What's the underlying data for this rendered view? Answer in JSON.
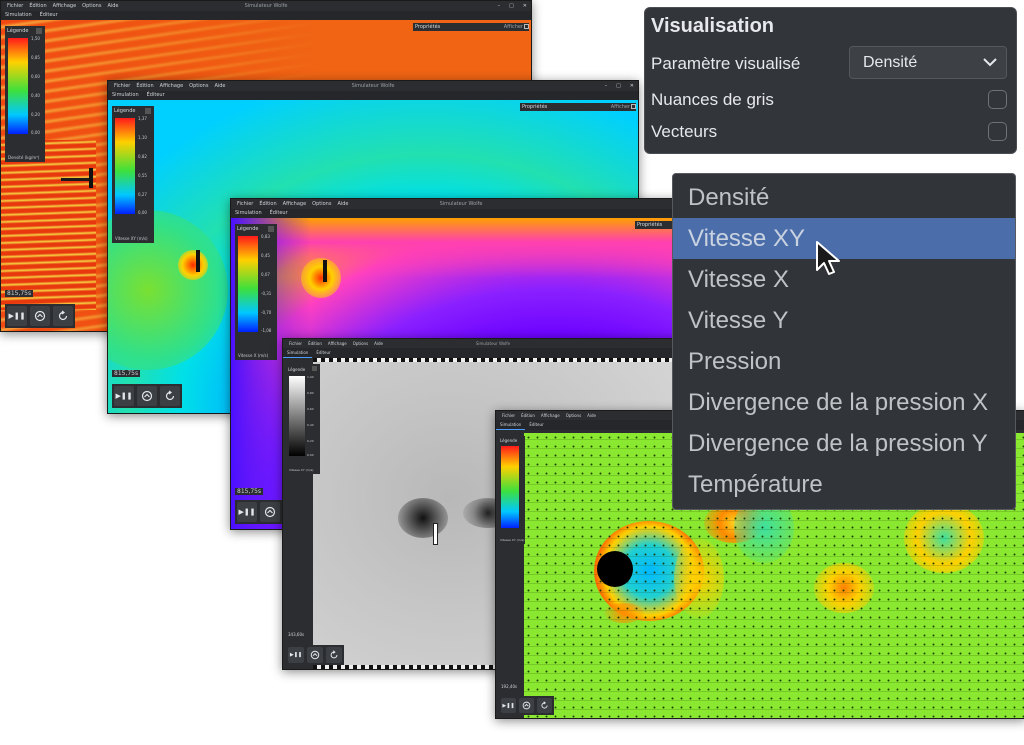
{
  "app_title": "Simulateur Wolfe",
  "menu": [
    "Fichier",
    "Édition",
    "Affichage",
    "Options",
    "Aide"
  ],
  "tabs": [
    "Simulation",
    "Éditeur"
  ],
  "legend_title": "Légende",
  "properties_title": "Propriétés",
  "properties_show": "Afficher",
  "windows": [
    {
      "legend_ticks": [
        "1,50",
        "0,85",
        "0,60",
        "0,40",
        "0,20",
        "0,00"
      ],
      "legend_unit": "Densité (kg/m³)",
      "time": "815,75s"
    },
    {
      "legend_ticks": [
        "1,37",
        "1,10",
        "0,82",
        "0,55",
        "0,27",
        "0,00"
      ],
      "legend_unit": "Vitesse XY (m/s)",
      "time": "815,75s"
    },
    {
      "legend_ticks": [
        "0,83",
        "0,45",
        "0,07",
        "-0,31",
        "-0,70",
        "-1,08"
      ],
      "legend_unit": "Vitesse X (m/s)",
      "time": "815,75s"
    },
    {
      "legend_ticks": [
        "1,00",
        "0,80",
        "0,60",
        "0,40",
        "0,20",
        "0,00"
      ],
      "legend_unit": "Vitesse XY (m/s)",
      "time": "343,60s"
    },
    {
      "legend_ticks": [],
      "legend_unit": "Vitesse XY (m/s)",
      "time": "192,40s"
    }
  ],
  "panel": {
    "title": "Visualisation",
    "param_label": "Paramètre visualisé",
    "param_value": "Densité",
    "grayscale_label": "Nuances de gris",
    "vectors_label": "Vecteurs"
  },
  "dropdown": {
    "options": [
      "Densité",
      "Vitesse XY",
      "Vitesse X",
      "Vitesse Y",
      "Pression",
      "Divergence de la pression X",
      "Divergence de la pression Y",
      "Température"
    ],
    "selected": "Vitesse XY"
  }
}
